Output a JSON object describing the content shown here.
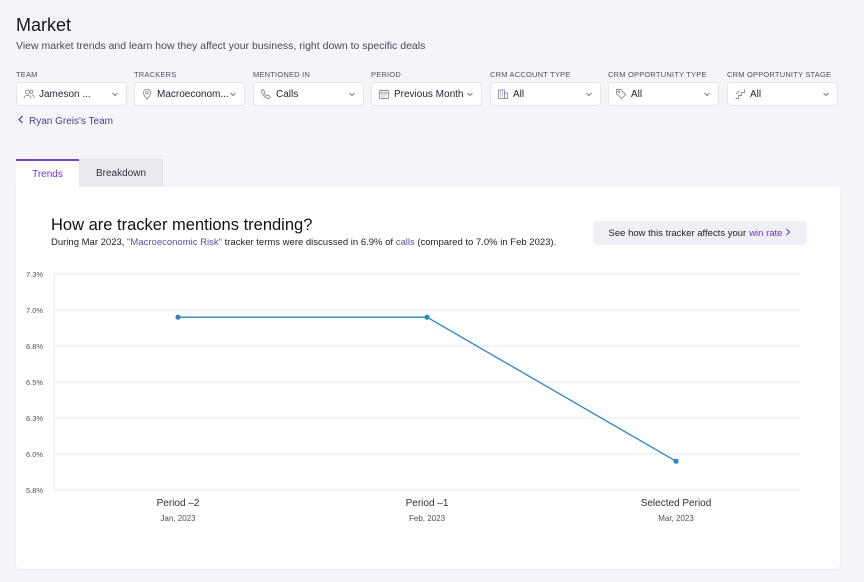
{
  "page": {
    "title": "Market",
    "subtitle": "View market trends and learn how they affect your business, right down to specific deals"
  },
  "filters": [
    {
      "label": "TEAM",
      "value": "Jameson ...",
      "icon": "people-icon"
    },
    {
      "label": "TRACKERS",
      "value": "Macroeconom...",
      "icon": "location-pin-icon"
    },
    {
      "label": "MENTIONED IN",
      "value": "Calls",
      "icon": "phone-icon"
    },
    {
      "label": "PERIOD",
      "value": "Previous Month",
      "icon": "calendar-icon"
    },
    {
      "label": "CRM ACCOUNT TYPE",
      "value": "All",
      "icon": "building-icon"
    },
    {
      "label": "CRM OPPORTUNITY TYPE",
      "value": "All",
      "icon": "tag-icon"
    },
    {
      "label": "CRM OPPORTUNITY STAGE",
      "value": "All",
      "icon": "stairs-icon"
    }
  ],
  "back_link": "Ryan Greis's Team",
  "tabs": [
    {
      "label": "Trends",
      "active": true
    },
    {
      "label": "Breakdown",
      "active": false
    }
  ],
  "card": {
    "title": "How are tracker mentions trending?",
    "desc_prefix": "During Mar 2023, ",
    "desc_tracker": "\"Macroeconomic Risk\"",
    "desc_middle": " tracker terms were discussed in 6.9% of ",
    "desc_calls": "calls",
    "desc_suffix": " (compared to 7.0% in Feb 2023).",
    "winrate_prefix": "See how this tracker affects your",
    "winrate_link": "win rate"
  },
  "colors": {
    "accent": "#6a38c7",
    "line": "#2b87c3"
  },
  "chart_data": {
    "type": "line",
    "categories": [
      "Period –2",
      "Period –1",
      "Selected Period"
    ],
    "category_dates": [
      "Jan, 2023",
      "Feb, 2023",
      "Mar, 2023"
    ],
    "series": [
      {
        "values": [
          7.0,
          7.0,
          6.0
        ]
      }
    ],
    "yticks": [
      "7.3%",
      "7.0%",
      "6.8%",
      "6.5%",
      "6.3%",
      "6.0%",
      "5.8%"
    ],
    "ylim": [
      5.8,
      7.3
    ],
    "grid": true
  }
}
